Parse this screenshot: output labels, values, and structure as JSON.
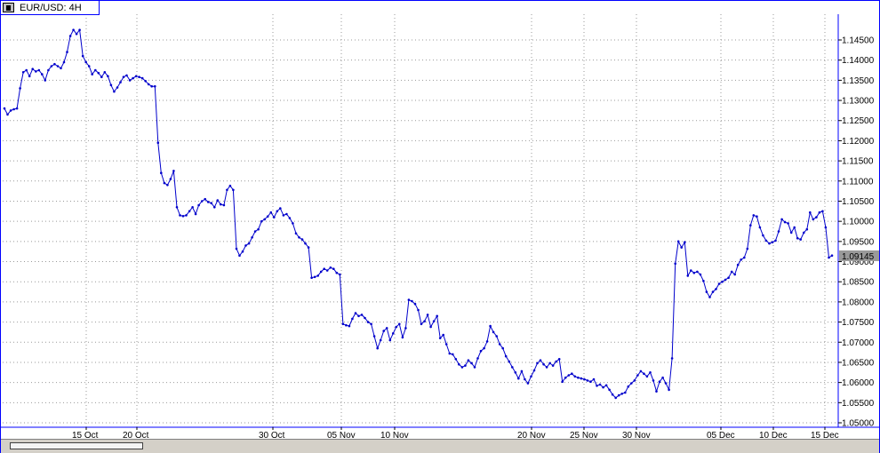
{
  "window": {
    "title": "EUR/USD: 4H"
  },
  "icons": {
    "window_menu": "window-menu-icon"
  },
  "colors": {
    "series": "#0000cc",
    "grid": "#999999",
    "frame": "#0000ff",
    "price_tag_bg": "#999999",
    "price_tag_text": "#ffffff"
  },
  "chart_data": {
    "type": "line",
    "title": "EUR/USD: 4H",
    "xlabel": "",
    "ylabel": "",
    "ylim": [
      1.05,
      1.1475
    ],
    "grid": true,
    "x_ticks": [
      "15 Oct",
      "20 Oct",
      "30 Oct",
      "05 Nov",
      "10 Nov",
      "20 Nov",
      "25 Nov",
      "30 Nov",
      "05 Dec",
      "10 Dec",
      "15 Dec"
    ],
    "y_ticks": [
      "1.14500",
      "1.14000",
      "1.13500",
      "1.13000",
      "1.12500",
      "1.12000",
      "1.11500",
      "1.11000",
      "1.10500",
      "1.10000",
      "1.09500",
      "1.09000",
      "1.08500",
      "1.08000",
      "1.07500",
      "1.07000",
      "1.06500",
      "1.06000",
      "1.05500",
      "1.05000"
    ],
    "last_price": "1.09145",
    "series": [
      {
        "values": [
          1.128,
          1.1265,
          1.1275,
          1.1278,
          1.128,
          1.133,
          1.137,
          1.1375,
          1.136,
          1.1378,
          1.1372,
          1.1375,
          1.1365,
          1.135,
          1.1375,
          1.1385,
          1.139,
          1.1385,
          1.138,
          1.1395,
          1.142,
          1.146,
          1.1475,
          1.1465,
          1.1475,
          1.141,
          1.1395,
          1.1385,
          1.1365,
          1.1375,
          1.1368,
          1.1358,
          1.137,
          1.136,
          1.1338,
          1.1322,
          1.1332,
          1.1345,
          1.1358,
          1.1362,
          1.135,
          1.1355,
          1.136,
          1.1358,
          1.1355,
          1.1348,
          1.134,
          1.1335,
          1.1335,
          1.1195,
          1.112,
          1.1095,
          1.109,
          1.1105,
          1.1125,
          1.1035,
          1.1015,
          1.1013,
          1.1015,
          1.1025,
          1.1035,
          1.1018,
          1.104,
          1.105,
          1.1055,
          1.1048,
          1.1045,
          1.1035,
          1.1052,
          1.1042,
          1.104,
          1.1078,
          1.1088,
          1.1078,
          1.0932,
          1.0915,
          1.0925,
          1.094,
          1.0945,
          1.096,
          1.0975,
          1.098,
          1.1,
          1.1005,
          1.1012,
          1.1022,
          1.101,
          1.1025,
          1.1032,
          1.1015,
          1.1018,
          1.1008,
          1.0995,
          1.097,
          1.096,
          1.0955,
          1.0945,
          1.0935,
          1.086,
          1.0862,
          1.0865,
          1.0875,
          1.0882,
          1.0878,
          1.0885,
          1.0882,
          1.0872,
          1.0868,
          1.0745,
          1.0742,
          1.074,
          1.0758,
          1.0772,
          1.0765,
          1.0768,
          1.076,
          1.075,
          1.0745,
          1.0715,
          1.0685,
          1.0705,
          1.0728,
          1.0735,
          1.0705,
          1.0722,
          1.0738,
          1.0745,
          1.0712,
          1.0735,
          1.0805,
          1.0802,
          1.0795,
          1.078,
          1.0745,
          1.0752,
          1.0768,
          1.0738,
          1.0752,
          1.0765,
          1.071,
          1.0718,
          1.0695,
          1.0672,
          1.067,
          1.0658,
          1.0645,
          1.0638,
          1.0642,
          1.0655,
          1.0648,
          1.0638,
          1.066,
          1.0678,
          1.0685,
          1.0702,
          1.074,
          1.0725,
          1.0715,
          1.0695,
          1.0685,
          1.0665,
          1.0652,
          1.0638,
          1.0625,
          1.061,
          1.0628,
          1.0608,
          1.0598,
          1.0615,
          1.063,
          1.0648,
          1.0655,
          1.0645,
          1.0638,
          1.0648,
          1.0642,
          1.0652,
          1.0658,
          1.0602,
          1.0612,
          1.0618,
          1.0622,
          1.0615,
          1.0612,
          1.061,
          1.0608,
          1.0605,
          1.0602,
          1.0608,
          1.0592,
          1.0595,
          1.0588,
          1.0593,
          1.0582,
          1.057,
          1.0562,
          1.0568,
          1.0572,
          1.0575,
          1.059,
          1.0598,
          1.0605,
          1.0618,
          1.0628,
          1.0622,
          1.0615,
          1.0625,
          1.0605,
          1.0578,
          1.0602,
          1.0612,
          1.0598,
          1.0582,
          1.066,
          1.0895,
          1.095,
          1.0935,
          1.0948,
          1.0865,
          1.0878,
          1.0872,
          1.0875,
          1.0868,
          1.0852,
          1.0825,
          1.0812,
          1.0825,
          1.0832,
          1.0845,
          1.085,
          1.0855,
          1.086,
          1.0875,
          1.0868,
          1.0892,
          1.0905,
          1.091,
          1.0932,
          1.099,
          1.1015,
          1.1012,
          1.0985,
          1.0965,
          1.0952,
          1.0945,
          1.0948,
          1.0952,
          1.0975,
          1.1005,
          1.0998,
          1.0995,
          1.0972,
          1.0985,
          1.0958,
          1.0955,
          1.0972,
          1.098,
          1.1022,
          1.1005,
          1.101,
          1.1022,
          1.1025,
          1.0985,
          1.091,
          1.0915
        ]
      }
    ]
  }
}
